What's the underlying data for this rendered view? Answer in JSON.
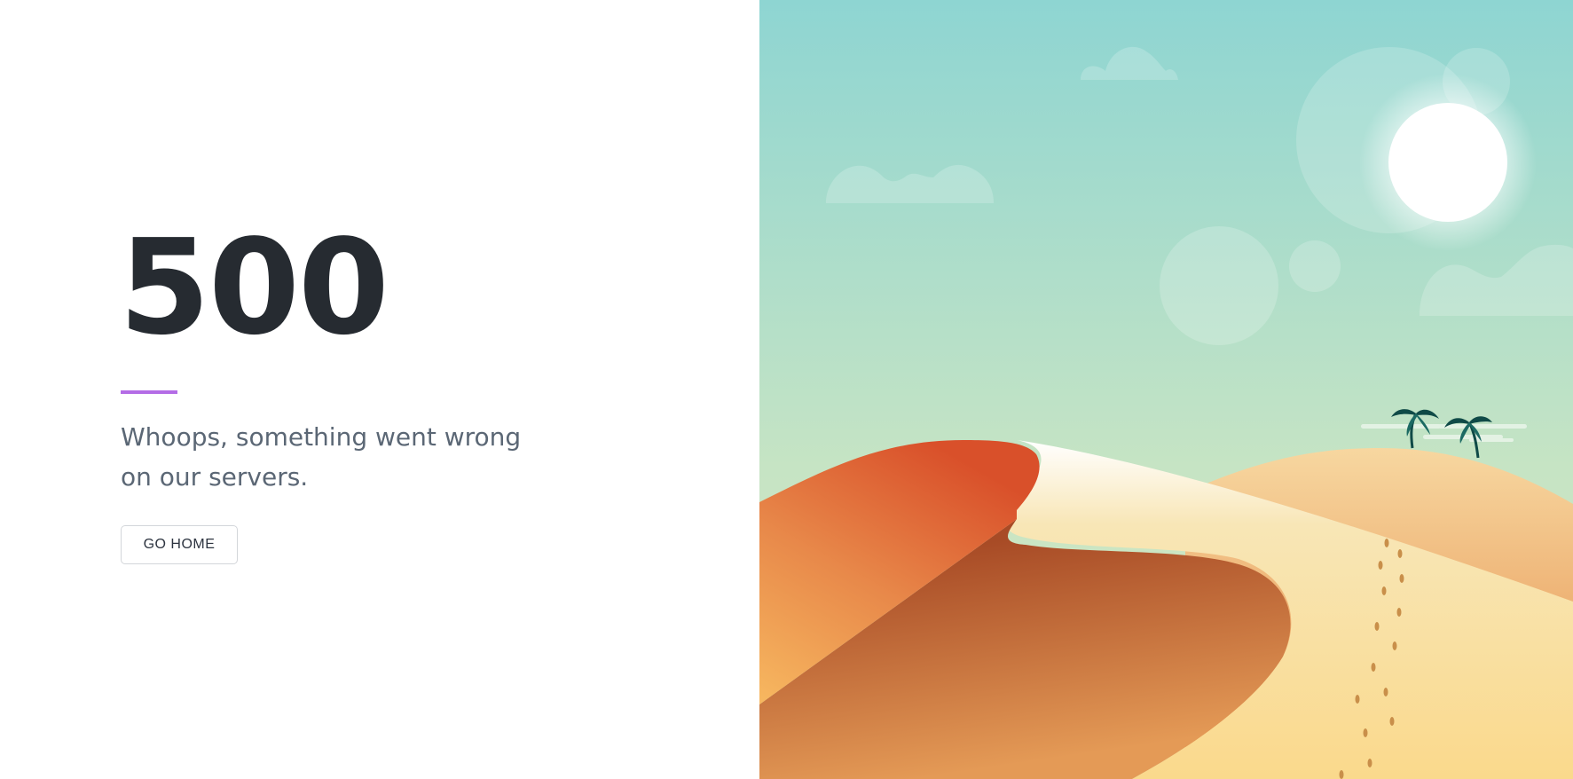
{
  "error": {
    "code": "500",
    "message": "Whoops, something went wrong on our servers."
  },
  "actions": {
    "go_home_label": "GO HOME"
  },
  "colors": {
    "text_dark": "#262b31",
    "accent": "#b46ce6",
    "message_text": "#5b6775",
    "sky_top": "#8ed5d2",
    "sky_bottom": "#cde7c3",
    "dune_dark": "#a84b26",
    "dune_light": "#f8dd9f"
  },
  "illustration": {
    "name": "desert-dunes-illustration",
    "elements": [
      "sun",
      "clouds",
      "sand-dunes",
      "palm-trees",
      "footprints"
    ]
  }
}
